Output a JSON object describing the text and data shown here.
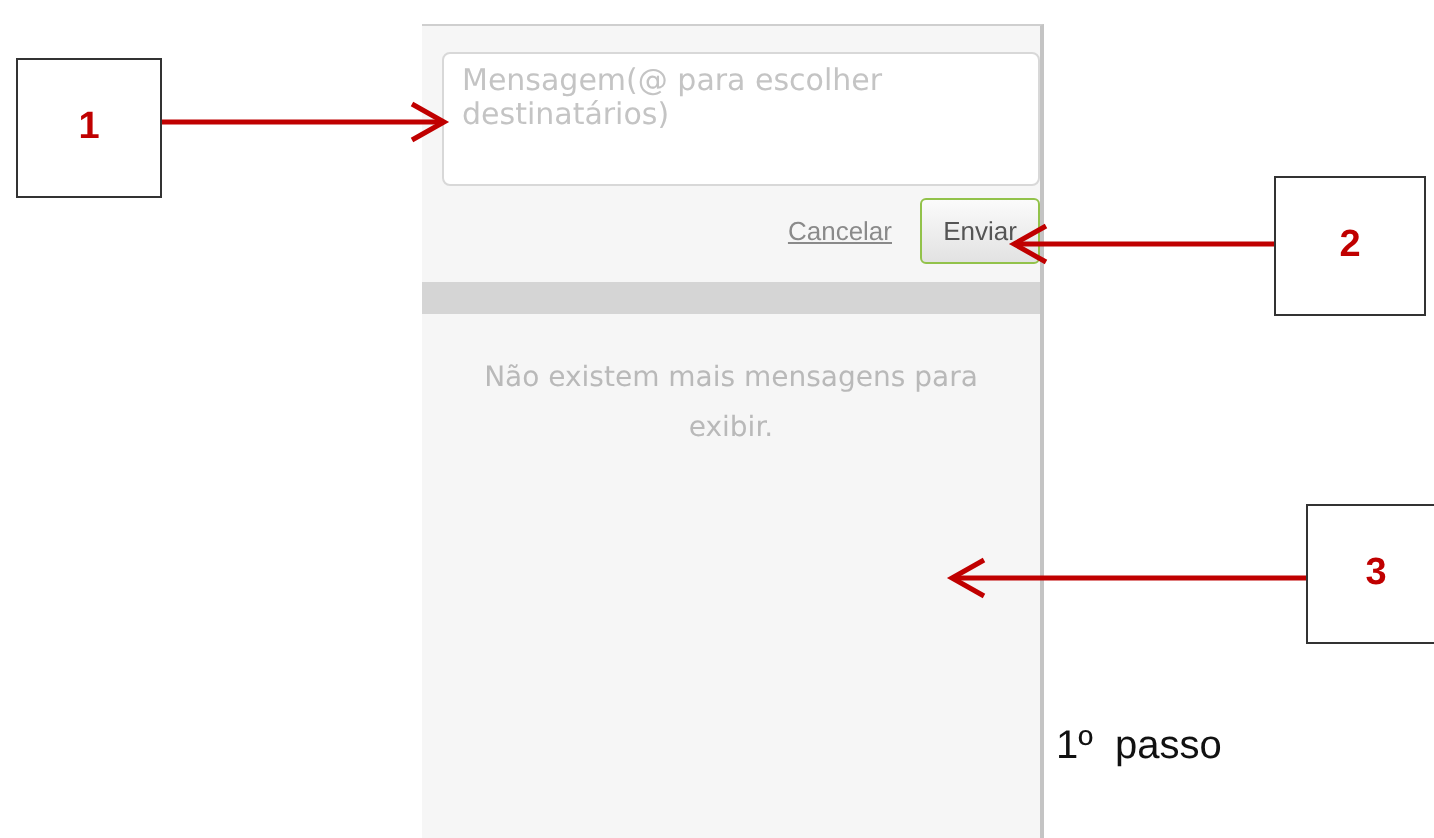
{
  "panel": {
    "message_field": {
      "placeholder": "Mensagem(@ para escolher destinatários)"
    },
    "cancel_link": "Cancelar",
    "send_button": "Enviar",
    "empty_message": "Não existem mais mensagens para exibir."
  },
  "callouts": [
    {
      "label": "1",
      "kind": "rightward"
    },
    {
      "label": "2",
      "kind": "leftward"
    },
    {
      "label": "3",
      "kind": "leftward"
    }
  ],
  "caption": "1º  passo"
}
